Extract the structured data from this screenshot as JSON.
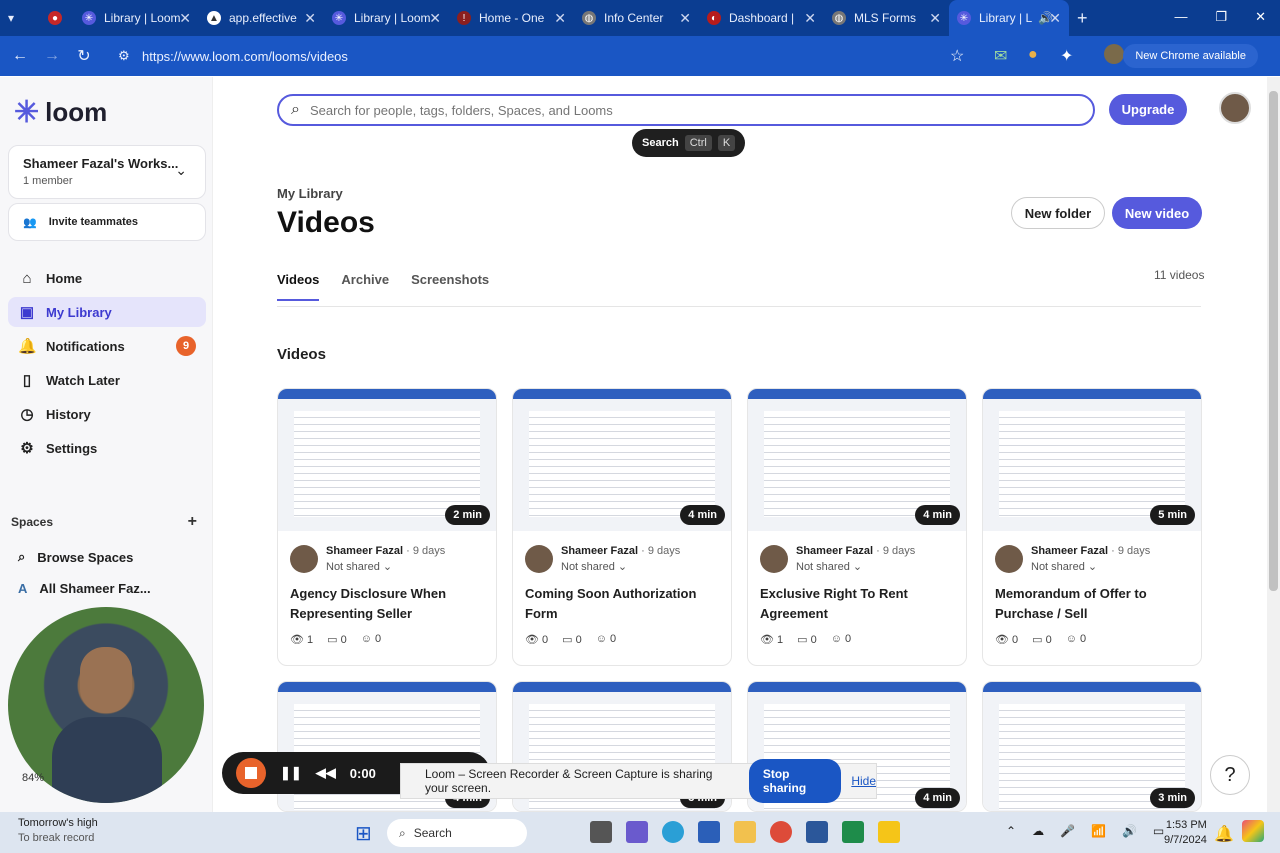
{
  "browser": {
    "tabs": [
      {
        "label": "Library | Loom"
      },
      {
        "label": "app.effective"
      },
      {
        "label": "Library | Loom"
      },
      {
        "label": "Home - One"
      },
      {
        "label": "Info Center"
      },
      {
        "label": "Dashboard |"
      },
      {
        "label": "MLS Forms"
      },
      {
        "label": "Library | L"
      }
    ],
    "url": "https://www.loom.com/looms/videos",
    "chrome_update": "New Chrome available"
  },
  "sidebar": {
    "logo": "loom",
    "workspace_name": "Shameer Fazal's Works...",
    "workspace_members": "1 member",
    "invite": "Invite teammates",
    "nav": [
      {
        "label": "Home"
      },
      {
        "label": "My Library"
      },
      {
        "label": "Notifications"
      },
      {
        "label": "Watch Later"
      },
      {
        "label": "History"
      },
      {
        "label": "Settings"
      }
    ],
    "notifications_count": "9",
    "spaces_heading": "Spaces",
    "browse_spaces": "Browse Spaces",
    "space_initial": "A",
    "space_name": "All Shameer Faz...",
    "camera_percent": "84%"
  },
  "header": {
    "search_placeholder": "Search for people, tags, folders, Spaces, and Looms",
    "tooltip_label": "Search",
    "tooltip_key1": "Ctrl",
    "tooltip_key2": "K",
    "upgrade": "Upgrade"
  },
  "main": {
    "breadcrumb": "My Library",
    "title": "Videos",
    "new_folder": "New folder",
    "new_video": "New video",
    "tabs": [
      {
        "label": "Videos"
      },
      {
        "label": "Archive"
      },
      {
        "label": "Screenshots"
      }
    ],
    "video_count": "11 videos",
    "section": "Videos",
    "cards": [
      {
        "duration": "2 min",
        "author": "Shameer Fazal",
        "ago": "· 9 days",
        "share": "Not shared",
        "title": "Agency Disclosure When Representing Seller",
        "views": "1",
        "comments": "0",
        "reactions": "0"
      },
      {
        "duration": "4 min",
        "author": "Shameer Fazal",
        "ago": "· 9 days",
        "share": "Not shared",
        "title": "Coming Soon Authorization Form",
        "views": "0",
        "comments": "0",
        "reactions": "0"
      },
      {
        "duration": "4 min",
        "author": "Shameer Fazal",
        "ago": "· 9 days",
        "share": "Not shared",
        "title": "Exclusive Right To Rent Agreement",
        "views": "1",
        "comments": "0",
        "reactions": "0"
      },
      {
        "duration": "5 min",
        "author": "Shameer Fazal",
        "ago": "· 9 days",
        "share": "Not shared",
        "title": "Memorandum of Offer to Purchase / Sell",
        "views": "0",
        "comments": "0",
        "reactions": "0"
      }
    ],
    "row2_durations": [
      "4 min",
      "3 min",
      "4 min",
      "3 min"
    ]
  },
  "recorder": {
    "timer": "0:00",
    "sharing_message": "Loom – Screen Recorder & Screen Capture is sharing your screen.",
    "stop_sharing": "Stop sharing",
    "hide": "Hide"
  },
  "taskbar": {
    "weather_title": "Tomorrow's high",
    "weather_sub": "To break record",
    "search": "Search",
    "time": "1:53 PM",
    "date": "9/7/2024"
  }
}
